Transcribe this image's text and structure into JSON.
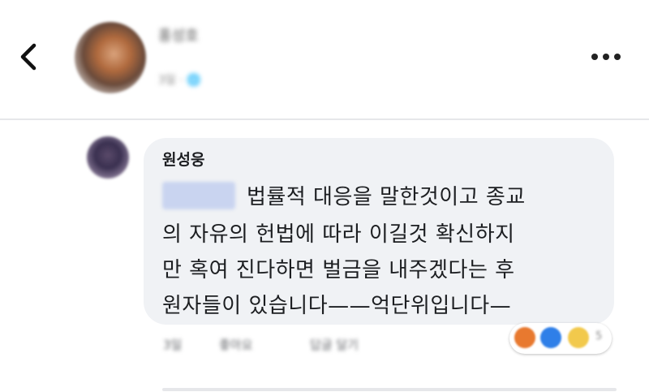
{
  "post": {
    "author_name": "홍성호",
    "meta": "3일 · 🌐"
  },
  "icons": {
    "back": "chevron-left-icon",
    "more": "more-horizontal-icon"
  },
  "comment": {
    "author": "원성웅",
    "mention": "",
    "lines": [
      "법률적 대응을 말한것이고 종교",
      "의 자유의 헌법에 따라 이길것 확신하지",
      "만 혹여 진다하면 벌금을 내주겠다는 후",
      "원자들이 있습니다——억단위입니다—"
    ],
    "reactions": {
      "types": [
        "haha",
        "like",
        "wow"
      ],
      "count": "5"
    },
    "actions": {
      "time": "3일",
      "like": "좋아요",
      "reply": "답글 달기"
    }
  },
  "colors": {
    "bubble": "#f0f2f5",
    "text": "#1c1e21",
    "secondary": "#65676b"
  }
}
